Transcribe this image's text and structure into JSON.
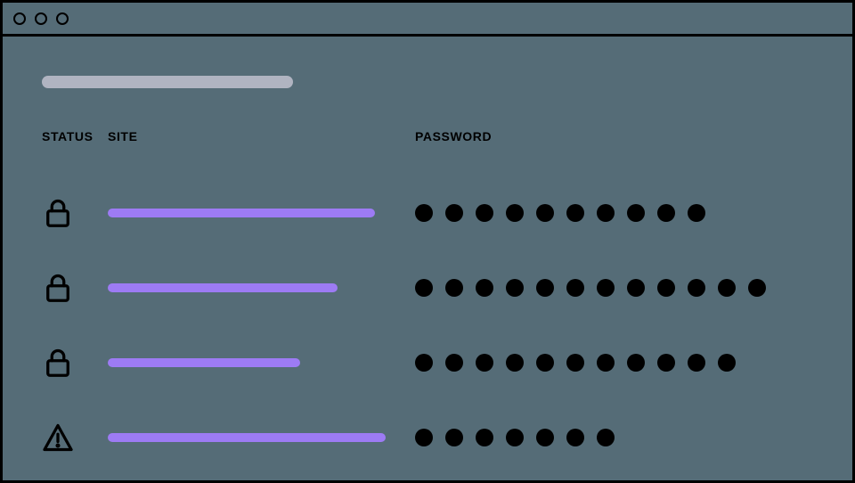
{
  "headers": {
    "status": "STATUS",
    "site": "SITE",
    "password": "PASSWORD"
  },
  "title_placeholder_width": 282,
  "rows": [
    {
      "status": "lock",
      "site_bar_width": 300,
      "password_length": 10
    },
    {
      "status": "lock",
      "site_bar_width": 258,
      "password_length": 12
    },
    {
      "status": "lock",
      "site_bar_width": 216,
      "password_length": 11
    },
    {
      "status": "alert",
      "site_bar_width": 312,
      "password_length": 7
    }
  ],
  "colors": {
    "background": "#556C77",
    "site_bar": "#9D7BF4",
    "title_placeholder": "#B0B4C1"
  }
}
